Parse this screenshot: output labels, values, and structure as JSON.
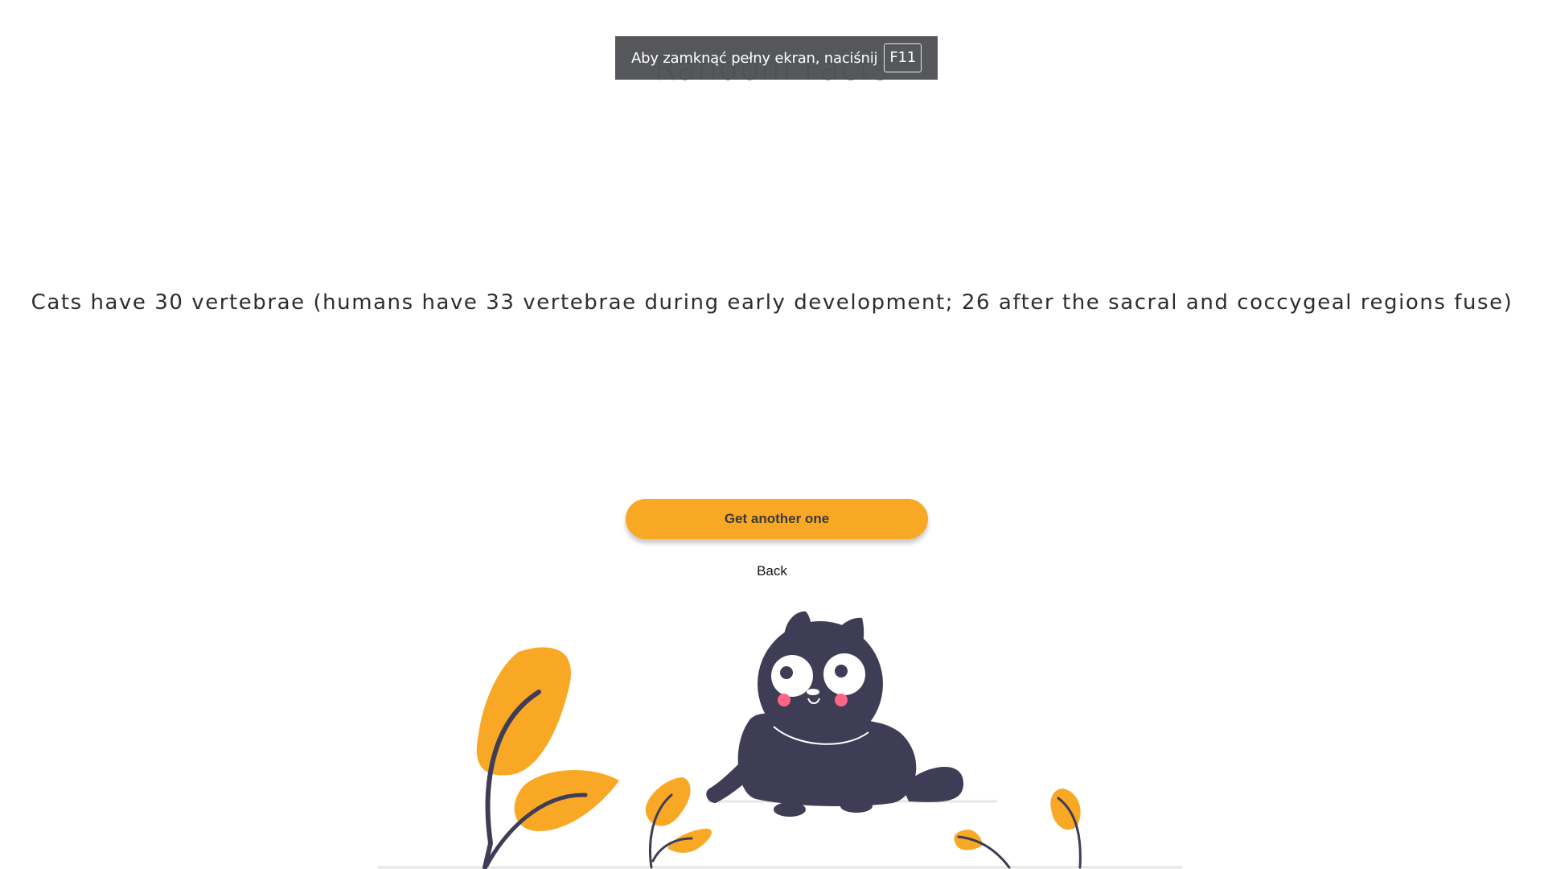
{
  "page": {
    "title": "Random Facts",
    "fact": "Cats have 30 vertebrae (humans have 33 vertebrae during early development; 26 after the sacral and coccygeal regions fuse)",
    "primary_button": "Get another one",
    "back_link": "Back"
  },
  "fullscreen_notice": {
    "text": "Aby zamknąć pełny ekran, naciśnij",
    "key": "F11"
  },
  "illustration": {
    "icon": "cat-with-leaves-illustration"
  },
  "colors": {
    "accent": "#f9a826",
    "ink": "#3f3d56",
    "blush": "#ff6584",
    "ground": "#e6e6e6",
    "notice_bg": "#505256"
  }
}
